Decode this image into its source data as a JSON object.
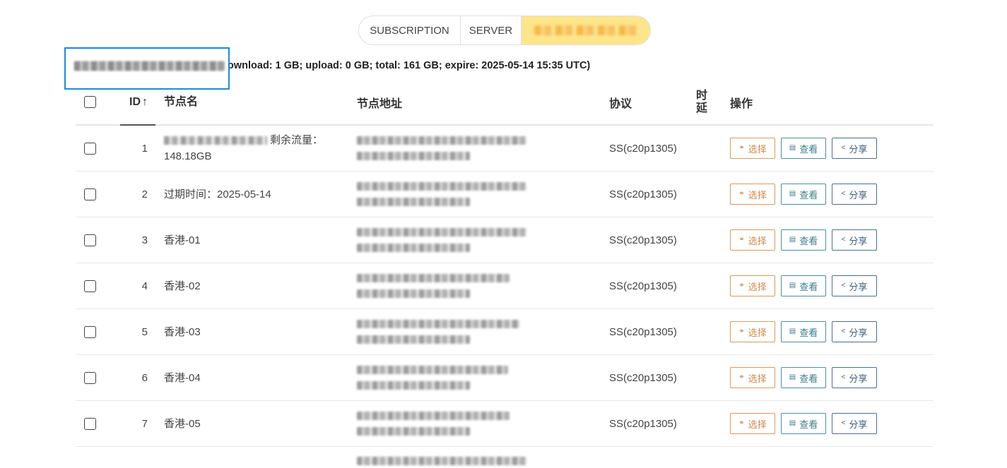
{
  "tabs": [
    {
      "label": "SUBSCRIPTION"
    },
    {
      "label": "SERVER"
    },
    {
      "label": ""
    }
  ],
  "info": {
    "stats_text": "ownload: 1 GB; upload: 0 GB; total: 161 GB; expire: 2025-05-14 15:35 UTC)"
  },
  "table": {
    "headers": {
      "id": "ID",
      "sort_icon": "↑",
      "name": "节点名",
      "address": "节点地址",
      "protocol": "协议",
      "latency": "时延",
      "actions": "操作"
    },
    "buttons": {
      "select": "选择",
      "view": "查看",
      "share": "分享",
      "select_icon": "link-icon",
      "view_icon": "document-icon",
      "share_icon": "share-icon"
    },
    "rows": [
      {
        "id": "1",
        "name": "剩余流量：148.18GB",
        "protocol": "SS(c20p1305)",
        "latency": ""
      },
      {
        "id": "2",
        "name": "过期时间：2025-05-14",
        "protocol": "SS(c20p1305)",
        "latency": ""
      },
      {
        "id": "3",
        "name": "香港-01",
        "protocol": "SS(c20p1305)",
        "latency": ""
      },
      {
        "id": "4",
        "name": "香港-02",
        "protocol": "SS(c20p1305)",
        "latency": ""
      },
      {
        "id": "5",
        "name": "香港-03",
        "protocol": "SS(c20p1305)",
        "latency": ""
      },
      {
        "id": "6",
        "name": "香港-04",
        "protocol": "SS(c20p1305)",
        "latency": ""
      },
      {
        "id": "7",
        "name": "香港-05",
        "protocol": "SS(c20p1305)",
        "latency": ""
      }
    ]
  },
  "colors": {
    "active_tab": "#fde58a",
    "select_button": "#cf8a4c",
    "view_button": "#3d7f8a",
    "share_button": "#3e5f80",
    "focus_outline": "#1a8be0"
  }
}
